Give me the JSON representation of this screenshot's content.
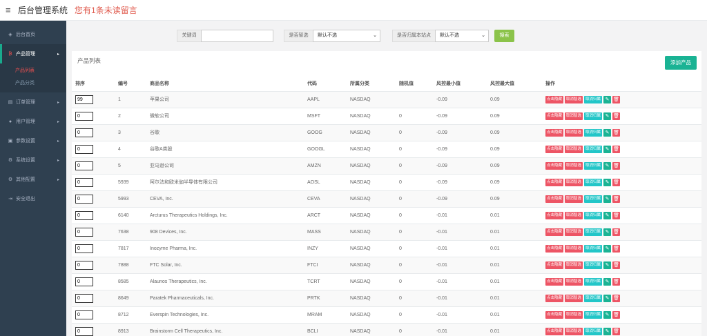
{
  "header": {
    "title": "后台管理系统",
    "notice": "您有1条未读留言"
  },
  "sidebar": {
    "items": [
      {
        "label": "后台首页",
        "icon": "dashboard-icon",
        "glyph": "◈"
      },
      {
        "label": "产品管理",
        "icon": "product-icon",
        "glyph": "₿",
        "active": true
      },
      {
        "label": "订单管理",
        "icon": "order-icon",
        "glyph": "▤"
      },
      {
        "label": "用户管理",
        "icon": "user-icon",
        "glyph": "●"
      },
      {
        "label": "参数设置",
        "icon": "params-icon",
        "glyph": "▣"
      },
      {
        "label": "系统设置",
        "icon": "settings-icon",
        "glyph": "⚙"
      },
      {
        "label": "其他配置",
        "icon": "config-icon",
        "glyph": "⚙"
      },
      {
        "label": "安全退出",
        "icon": "logout-icon",
        "glyph": "⇥"
      }
    ],
    "sub": [
      {
        "label": "产品列表",
        "current": true
      },
      {
        "label": "产品分类"
      }
    ]
  },
  "search": {
    "keyword_label": "关键词",
    "keyword_value": "",
    "select1_label": "是否智选",
    "select1_value": "默认不选",
    "select2_label": "是否归属本站点",
    "select2_value": "默认不选",
    "button": "搜索"
  },
  "card": {
    "title": "产品列表",
    "add_button": "添加产品"
  },
  "table": {
    "columns": [
      "排序",
      "编号",
      "商品名称",
      "代码",
      "所属分类",
      "随机值",
      "风控最小值",
      "风控最大值",
      "操作"
    ],
    "op_labels": [
      "点击隐藏",
      "取消智选",
      "取消归属",
      "编辑",
      "删除"
    ],
    "rows": [
      {
        "sort": "99",
        "id": "1",
        "name": "苹果公司",
        "code": "AAPL",
        "category": "NASDAQ",
        "random": "",
        "min": "-0.09",
        "max": "0.09"
      },
      {
        "sort": "0",
        "id": "2",
        "name": "微软公司",
        "code": "MSFT",
        "category": "NASDAQ",
        "random": "0",
        "min": "-0.09",
        "max": "0.09"
      },
      {
        "sort": "0",
        "id": "3",
        "name": "谷歌",
        "code": "GOOG",
        "category": "NASDAQ",
        "random": "0",
        "min": "-0.09",
        "max": "0.09"
      },
      {
        "sort": "0",
        "id": "4",
        "name": "谷歌A类股",
        "code": "GOOGL",
        "category": "NASDAQ",
        "random": "0",
        "min": "-0.09",
        "max": "0.09"
      },
      {
        "sort": "0",
        "id": "5",
        "name": "亚马逊公司",
        "code": "AMZN",
        "category": "NASDAQ",
        "random": "0",
        "min": "-0.09",
        "max": "0.09"
      },
      {
        "sort": "0",
        "id": "5939",
        "name": "阿尔法和欧米伽半导体有限公司",
        "code": "AOSL",
        "category": "NASDAQ",
        "random": "0",
        "min": "-0.09",
        "max": "0.09"
      },
      {
        "sort": "0",
        "id": "5993",
        "name": "CEVA, Inc.",
        "code": "CEVA",
        "category": "NASDAQ",
        "random": "0",
        "min": "-0.09",
        "max": "0.09"
      },
      {
        "sort": "0",
        "id": "6140",
        "name": "Arcturus Therapeutics Holdings, Inc.",
        "code": "ARCT",
        "category": "NASDAQ",
        "random": "0",
        "min": "-0.01",
        "max": "0.01"
      },
      {
        "sort": "0",
        "id": "7638",
        "name": "908 Devices, Inc.",
        "code": "MASS",
        "category": "NASDAQ",
        "random": "0",
        "min": "-0.01",
        "max": "0.01"
      },
      {
        "sort": "0",
        "id": "7817",
        "name": "Inozyme Pharma, Inc.",
        "code": "INZY",
        "category": "NASDAQ",
        "random": "0",
        "min": "-0.01",
        "max": "0.01"
      },
      {
        "sort": "0",
        "id": "7888",
        "name": "FTC Solar, Inc.",
        "code": "FTCI",
        "category": "NASDAQ",
        "random": "0",
        "min": "-0.01",
        "max": "0.01"
      },
      {
        "sort": "0",
        "id": "8585",
        "name": "Alaunos Therapeutics, Inc.",
        "code": "TCRT",
        "category": "NASDAQ",
        "random": "0",
        "min": "-0.01",
        "max": "0.01"
      },
      {
        "sort": "0",
        "id": "8649",
        "name": "Paratek Pharmaceuticals, Inc.",
        "code": "PRTK",
        "category": "NASDAQ",
        "random": "0",
        "min": "-0.01",
        "max": "0.01"
      },
      {
        "sort": "0",
        "id": "8712",
        "name": "Everspin Technologies, Inc.",
        "code": "MRAM",
        "category": "NASDAQ",
        "random": "0",
        "min": "-0.01",
        "max": "0.01"
      },
      {
        "sort": "0",
        "id": "8913",
        "name": "Brainstorm Cell Therapeutics, Inc.",
        "code": "BCLI",
        "category": "NASDAQ",
        "random": "0",
        "min": "-0.01",
        "max": "0.01"
      }
    ]
  },
  "colors": {
    "sidebar": "#2f4050",
    "accent": "#1ab394",
    "danger": "#ed5565",
    "info": "#23c6c8",
    "search": "#8bc34a",
    "notice": "#e05a4d"
  }
}
